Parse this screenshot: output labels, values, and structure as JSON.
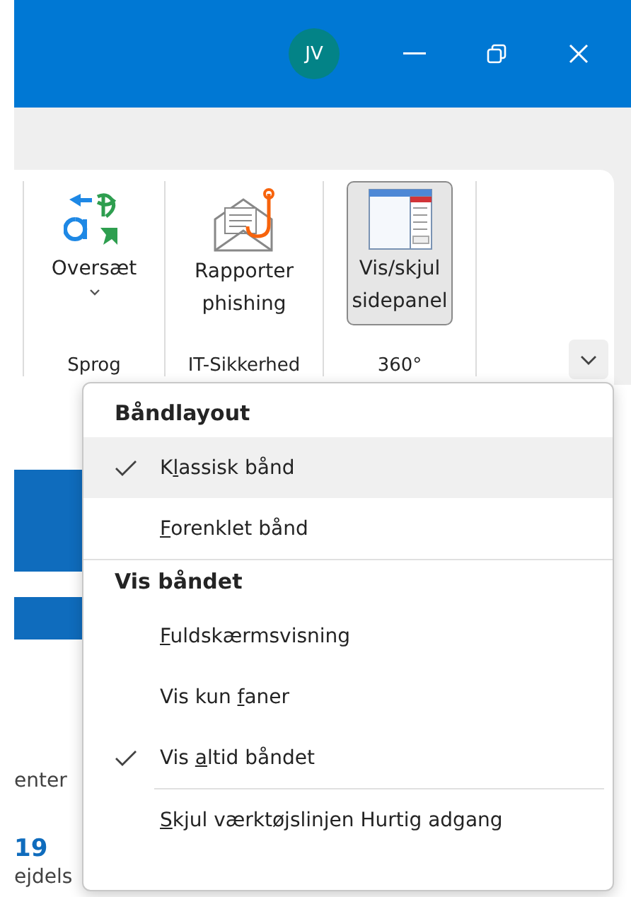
{
  "title_bar": {
    "avatar_initials": "JV",
    "controls": [
      {
        "kind": "minimize"
      },
      {
        "kind": "restore"
      },
      {
        "kind": "close"
      }
    ]
  },
  "ribbon": {
    "groups": [
      {
        "label": "Sprog",
        "button": {
          "kind": "translate",
          "label_lines": [
            "Oversæt"
          ],
          "has_dropdown": true,
          "selected": false
        }
      },
      {
        "label": "IT-Sikkerhed",
        "button": {
          "kind": "phishing",
          "label_lines": [
            "Rapporter",
            "phishing"
          ],
          "has_dropdown": false,
          "selected": false
        }
      },
      {
        "label": "360°",
        "button": {
          "kind": "sidepanel",
          "label_lines": [
            "Vis/skjul",
            "sidepanel"
          ],
          "has_dropdown": false,
          "selected": true
        }
      }
    ]
  },
  "background": {
    "texts": [
      {
        "kind": "plain",
        "text": "enter"
      },
      {
        "kind": "number",
        "text": "19"
      },
      {
        "kind": "plain",
        "text": "ejdels"
      }
    ]
  },
  "menu": {
    "sections": [
      {
        "heading": "Båndlayout",
        "items": [
          {
            "label": {
              "before": "K",
              "key": "l",
              "after": "assisk bånd"
            },
            "checked": true,
            "selected": true
          },
          {
            "label": {
              "key": "F",
              "after": "orenklet bånd"
            },
            "checked": false,
            "selected": false
          }
        ]
      },
      {
        "heading": "Vis båndet",
        "items": [
          {
            "label": {
              "key": "F",
              "after": "uldskærmsvisning"
            },
            "checked": false,
            "selected": false
          },
          {
            "label": {
              "before": "Vis kun ",
              "key": "f",
              "after": "aner"
            },
            "checked": false,
            "selected": false
          },
          {
            "label": {
              "before": "Vis ",
              "key": "a",
              "after": "ltid båndet"
            },
            "checked": true,
            "selected": false
          }
        ]
      },
      {
        "items": [
          {
            "label": {
              "key": "S",
              "after": "kjul værktøjslinjen Hurtig adgang"
            },
            "checked": false,
            "selected": false
          }
        ]
      }
    ]
  }
}
